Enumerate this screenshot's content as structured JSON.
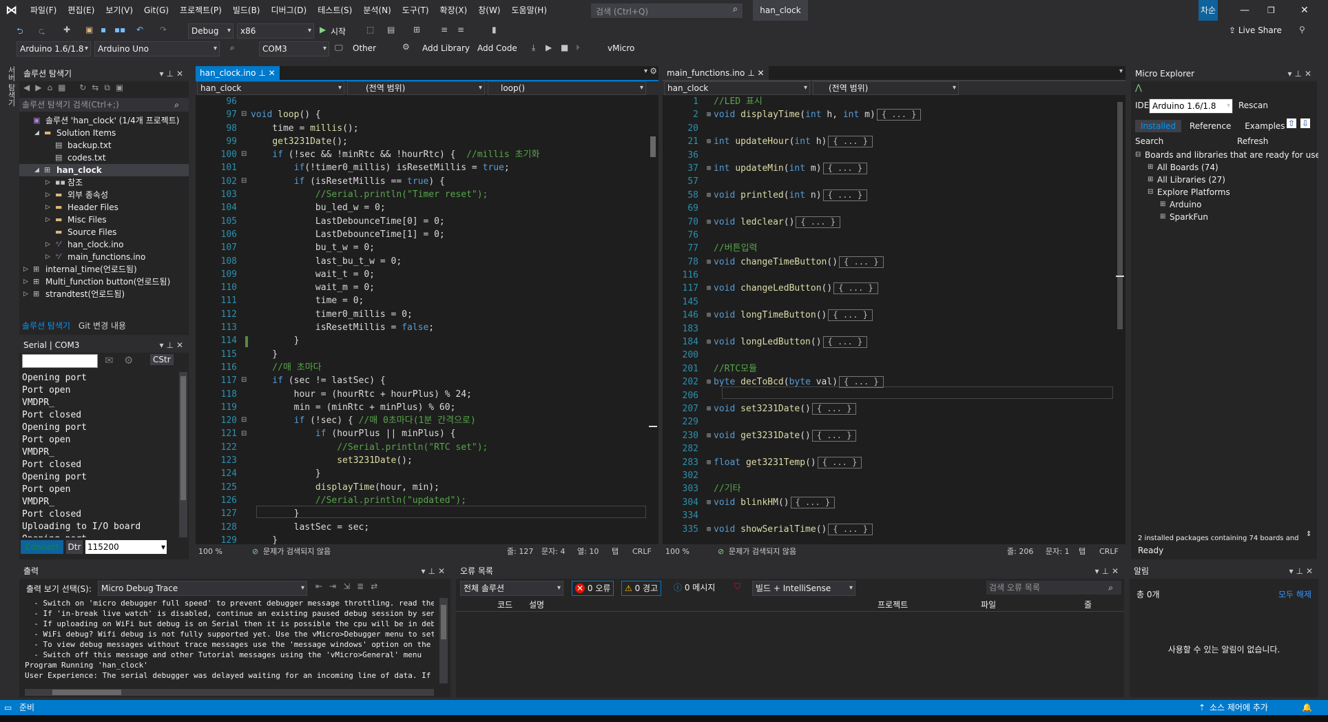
{
  "menu": {
    "items": [
      "파일(F)",
      "편집(E)",
      "보기(V)",
      "Git(G)",
      "프로젝트(P)",
      "빌드(B)",
      "디버그(D)",
      "테스트(S)",
      "분석(N)",
      "도구(T)",
      "확장(X)",
      "창(W)",
      "도움말(H)"
    ],
    "search_placeholder": "검색 (Ctrl+Q)",
    "solution_name": "han_clock",
    "user": "차순"
  },
  "toolbar": {
    "config": "Debug",
    "platform": "x86",
    "start": "시작",
    "live_share": "Live Share",
    "ide_version": "Arduino 1.6/1.8",
    "board": "Arduino Uno",
    "port": "COM3",
    "other": "Other",
    "add_library": "Add Library",
    "add_code": "Add Code",
    "vmicro": "vMicro"
  },
  "solution_explorer": {
    "title": "솔루션 탐색기",
    "search_placeholder": "솔루션 탐색기 검색(Ctrl+;)",
    "items": [
      {
        "label": "솔루션 'han_clock' (1/4개 프로젝트)",
        "indent": 0,
        "icon": "solution-icon",
        "bold": false
      },
      {
        "label": "Solution Items",
        "indent": 1,
        "icon": "folder-icon",
        "bold": false
      },
      {
        "label": "backup.txt",
        "indent": 2,
        "icon": "file-icon",
        "bold": false
      },
      {
        "label": "codes.txt",
        "indent": 2,
        "icon": "file-icon",
        "bold": false
      },
      {
        "label": "han_clock",
        "indent": 1,
        "icon": "project-icon",
        "bold": true
      },
      {
        "label": "참조",
        "indent": 2,
        "icon": "reference-icon",
        "bold": false
      },
      {
        "label": "외부 종속성",
        "indent": 2,
        "icon": "folder-icon",
        "bold": false
      },
      {
        "label": "Header Files",
        "indent": 2,
        "icon": "folder-icon",
        "bold": false
      },
      {
        "label": "Misc Files",
        "indent": 2,
        "icon": "folder-icon",
        "bold": false
      },
      {
        "label": "Source Files",
        "indent": 2,
        "icon": "folder-icon",
        "bold": false
      },
      {
        "label": "han_clock.ino",
        "indent": 2,
        "icon": "cpp-file-icon",
        "bold": false
      },
      {
        "label": "main_functions.ino",
        "indent": 2,
        "icon": "cpp-file-icon",
        "bold": false
      },
      {
        "label": "internal_time(언로드됨)",
        "indent": 0,
        "icon": "project-icon",
        "bold": false
      },
      {
        "label": "Multi_function button(언로드됨)",
        "indent": 0,
        "icon": "project-icon",
        "bold": false
      },
      {
        "label": "strandtest(언로드됨)",
        "indent": 0,
        "icon": "project-icon",
        "bold": false
      }
    ],
    "tabs": [
      "솔루션 탐색기",
      "Git 변경 내용"
    ]
  },
  "serial": {
    "title": "Serial | COM3",
    "cstr": "CStr",
    "connect": "Connect",
    "dtr": "Dtr",
    "baud": "115200",
    "lines": [
      "Opening port",
      "Port open",
      "VMDPR_",
      "Port closed",
      "Opening port",
      "Port open",
      "VMDPR_",
      "Port closed",
      "Opening port",
      "Port open",
      "VMDPR_",
      "Port closed",
      "Uploading to I/O board",
      "Opening port"
    ]
  },
  "editor1": {
    "tab": "han_clock.ino",
    "nav1": "han_clock",
    "nav2": "(전역 범위)",
    "nav3": "loop()",
    "zoom": "100 %",
    "issues": "문제가 검색되지 않음",
    "line": "줄: 127",
    "char": "문자: 4",
    "col": "열: 10",
    "tab_mode": "탭",
    "eol": "CRLF",
    "lines": [
      {
        "n": "96",
        "c": []
      },
      {
        "n": "97",
        "c": [
          [
            "kw",
            "void "
          ],
          [
            "fn",
            "loop"
          ],
          [
            "pl",
            "() {"
          ]
        ]
      },
      {
        "n": "98",
        "c": [
          [
            "pl",
            "    time = "
          ],
          [
            "fn",
            "millis"
          ],
          [
            "pl",
            "();"
          ]
        ]
      },
      {
        "n": "99",
        "c": [
          [
            "pl",
            "    "
          ],
          [
            "fn",
            "get3231Date"
          ],
          [
            "pl",
            "();"
          ]
        ]
      },
      {
        "n": "100",
        "c": [
          [
            "kw",
            "    if"
          ],
          [
            "pl",
            " (!sec && !minRtc && !hourRtc) {  "
          ],
          [
            "cm",
            "//millis 초기화"
          ]
        ]
      },
      {
        "n": "101",
        "c": [
          [
            "kw",
            "        if"
          ],
          [
            "pl",
            "(!timer0_millis) isResetMillis = "
          ],
          [
            "kw",
            "true"
          ],
          [
            "pl",
            ";"
          ]
        ]
      },
      {
        "n": "102",
        "c": [
          [
            "kw",
            "        if"
          ],
          [
            "pl",
            " (isResetMillis == "
          ],
          [
            "kw",
            "true"
          ],
          [
            "pl",
            ") {"
          ]
        ]
      },
      {
        "n": "103",
        "c": [
          [
            "cm",
            "            //Serial.println(\"Timer reset\");"
          ]
        ]
      },
      {
        "n": "104",
        "c": [
          [
            "pl",
            "            bu_led_w = 0;"
          ]
        ]
      },
      {
        "n": "105",
        "c": [
          [
            "pl",
            "            LastDebounceTime[0] = 0;"
          ]
        ]
      },
      {
        "n": "106",
        "c": [
          [
            "pl",
            "            LastDebounceTime[1] = 0;"
          ]
        ]
      },
      {
        "n": "107",
        "c": [
          [
            "pl",
            "            bu_t_w = 0;"
          ]
        ]
      },
      {
        "n": "108",
        "c": [
          [
            "pl",
            "            last_bu_t_w = 0;"
          ]
        ]
      },
      {
        "n": "109",
        "c": [
          [
            "pl",
            "            wait_t = 0;"
          ]
        ]
      },
      {
        "n": "110",
        "c": [
          [
            "pl",
            "            wait_m = 0;"
          ]
        ]
      },
      {
        "n": "111",
        "c": [
          [
            "pl",
            "            time = 0;"
          ]
        ]
      },
      {
        "n": "112",
        "c": [
          [
            "pl",
            "            timer0_millis = 0;"
          ]
        ]
      },
      {
        "n": "113",
        "c": [
          [
            "pl",
            "            isResetMillis = "
          ],
          [
            "kw",
            "false"
          ],
          [
            "pl",
            ";"
          ]
        ]
      },
      {
        "n": "114",
        "c": [
          [
            "pl",
            "        }"
          ]
        ]
      },
      {
        "n": "115",
        "c": [
          [
            "pl",
            "    }"
          ]
        ]
      },
      {
        "n": "116",
        "c": [
          [
            "cm",
            "    //매 초마다"
          ]
        ]
      },
      {
        "n": "117",
        "c": [
          [
            "kw",
            "    if"
          ],
          [
            "pl",
            " (sec != lastSec) {"
          ]
        ]
      },
      {
        "n": "118",
        "c": [
          [
            "pl",
            "        hour = (hourRtc + hourPlus) % 24;"
          ]
        ]
      },
      {
        "n": "119",
        "c": [
          [
            "pl",
            "        min = (minRtc + minPlus) % 60;"
          ]
        ]
      },
      {
        "n": "120",
        "c": [
          [
            "kw",
            "        if"
          ],
          [
            "pl",
            " (!sec) { "
          ],
          [
            "cm",
            "//매 0초마다(1분 간격으로)"
          ]
        ]
      },
      {
        "n": "121",
        "c": [
          [
            "kw",
            "            if"
          ],
          [
            "pl",
            " (hourPlus || minPlus) {"
          ]
        ]
      },
      {
        "n": "122",
        "c": [
          [
            "cm",
            "                //Serial.println(\"RTC set\");"
          ]
        ]
      },
      {
        "n": "123",
        "c": [
          [
            "pl",
            "                "
          ],
          [
            "fn",
            "set3231Date"
          ],
          [
            "pl",
            "();"
          ]
        ]
      },
      {
        "n": "124",
        "c": [
          [
            "pl",
            "            }"
          ]
        ]
      },
      {
        "n": "125",
        "c": [
          [
            "pl",
            "            "
          ],
          [
            "fn",
            "displayTime"
          ],
          [
            "pl",
            "(hour, min);"
          ]
        ]
      },
      {
        "n": "126",
        "c": [
          [
            "cm",
            "            //Serial.println(\"updated\");"
          ]
        ]
      },
      {
        "n": "127",
        "c": [
          [
            "pl",
            "        }"
          ]
        ]
      },
      {
        "n": "128",
        "c": [
          [
            "pl",
            "        lastSec = sec;"
          ]
        ]
      },
      {
        "n": "129",
        "c": [
          [
            "pl",
            "    }"
          ]
        ]
      },
      {
        "n": "130",
        "c": []
      }
    ]
  },
  "editor2": {
    "tab": "main_functions.ino",
    "nav1": "han_clock",
    "nav2": "(전역 범위)",
    "zoom": "100 %",
    "issues": "문제가 검색되지 않음",
    "line": "줄: 206",
    "char": "문자: 1",
    "tab_mode": "탭",
    "eol": "CRLF",
    "lines": [
      {
        "n": "1",
        "c": [
          [
            "cm",
            "//LED 표시"
          ]
        ],
        "fold": false
      },
      {
        "n": "2",
        "c": [
          [
            "kw",
            "void "
          ],
          [
            "fn",
            "displayTime"
          ],
          [
            "pl",
            "("
          ],
          [
            "kw",
            "int"
          ],
          [
            "pl",
            " h, "
          ],
          [
            "kw",
            "int"
          ],
          [
            "pl",
            " m)"
          ]
        ],
        "fold": true
      },
      {
        "n": "20",
        "c": [],
        "fold": false
      },
      {
        "n": "21",
        "c": [
          [
            "kw",
            "int "
          ],
          [
            "fn",
            "updateHour"
          ],
          [
            "pl",
            "("
          ],
          [
            "kw",
            "int"
          ],
          [
            "pl",
            " h)"
          ]
        ],
        "fold": true
      },
      {
        "n": "36",
        "c": [],
        "fold": false
      },
      {
        "n": "37",
        "c": [
          [
            "kw",
            "int "
          ],
          [
            "fn",
            "updateMin"
          ],
          [
            "pl",
            "("
          ],
          [
            "kw",
            "int"
          ],
          [
            "pl",
            " m)"
          ]
        ],
        "fold": true
      },
      {
        "n": "57",
        "c": [],
        "fold": false
      },
      {
        "n": "58",
        "c": [
          [
            "kw",
            "void "
          ],
          [
            "fn",
            "printled"
          ],
          [
            "pl",
            "("
          ],
          [
            "kw",
            "int"
          ],
          [
            "pl",
            " n)"
          ]
        ],
        "fold": true
      },
      {
        "n": "69",
        "c": [],
        "fold": false
      },
      {
        "n": "70",
        "c": [
          [
            "kw",
            "void "
          ],
          [
            "fn",
            "ledclear"
          ],
          [
            "pl",
            "()"
          ]
        ],
        "fold": true
      },
      {
        "n": "76",
        "c": [],
        "fold": false
      },
      {
        "n": "77",
        "c": [
          [
            "cm",
            "//버튼입력"
          ]
        ],
        "fold": false
      },
      {
        "n": "78",
        "c": [
          [
            "kw",
            "void "
          ],
          [
            "fn",
            "changeTimeButton"
          ],
          [
            "pl",
            "()"
          ]
        ],
        "fold": true
      },
      {
        "n": "116",
        "c": [],
        "fold": false
      },
      {
        "n": "117",
        "c": [
          [
            "kw",
            "void "
          ],
          [
            "fn",
            "changeLedButton"
          ],
          [
            "pl",
            "()"
          ]
        ],
        "fold": true
      },
      {
        "n": "145",
        "c": [],
        "fold": false
      },
      {
        "n": "146",
        "c": [
          [
            "kw",
            "void "
          ],
          [
            "fn",
            "longTimeButton"
          ],
          [
            "pl",
            "()"
          ]
        ],
        "fold": true
      },
      {
        "n": "183",
        "c": [],
        "fold": false
      },
      {
        "n": "184",
        "c": [
          [
            "kw",
            "void "
          ],
          [
            "fn",
            "longLedButton"
          ],
          [
            "pl",
            "()"
          ]
        ],
        "fold": true
      },
      {
        "n": "200",
        "c": [],
        "fold": false
      },
      {
        "n": "201",
        "c": [
          [
            "cm",
            "//RTC모듈"
          ]
        ],
        "fold": false
      },
      {
        "n": "202",
        "c": [
          [
            "kw",
            "byte "
          ],
          [
            "fn",
            "decToBcd"
          ],
          [
            "pl",
            "("
          ],
          [
            "kw",
            "byte"
          ],
          [
            "pl",
            " val)"
          ]
        ],
        "fold": true
      },
      {
        "n": "206",
        "c": [],
        "fold": false
      },
      {
        "n": "207",
        "c": [
          [
            "kw",
            "void "
          ],
          [
            "fn",
            "set3231Date"
          ],
          [
            "pl",
            "()"
          ]
        ],
        "fold": true
      },
      {
        "n": "229",
        "c": [],
        "fold": false
      },
      {
        "n": "230",
        "c": [
          [
            "kw",
            "void "
          ],
          [
            "fn",
            "get3231Date"
          ],
          [
            "pl",
            "()"
          ]
        ],
        "fold": true
      },
      {
        "n": "282",
        "c": [],
        "fold": false
      },
      {
        "n": "283",
        "c": [
          [
            "kw",
            "float "
          ],
          [
            "fn",
            "get3231Temp"
          ],
          [
            "pl",
            "()"
          ]
        ],
        "fold": true
      },
      {
        "n": "302",
        "c": [],
        "fold": false
      },
      {
        "n": "303",
        "c": [
          [
            "cm",
            "//기타"
          ]
        ],
        "fold": false
      },
      {
        "n": "304",
        "c": [
          [
            "kw",
            "void "
          ],
          [
            "fn",
            "blinkHM"
          ],
          [
            "pl",
            "()"
          ]
        ],
        "fold": true
      },
      {
        "n": "334",
        "c": [],
        "fold": false
      },
      {
        "n": "335",
        "c": [
          [
            "kw",
            "void "
          ],
          [
            "fn",
            "showSerialTime"
          ],
          [
            "pl",
            "()"
          ]
        ],
        "fold": true
      }
    ],
    "collapsed": "{ ... }"
  },
  "micro": {
    "title": "Micro Explorer",
    "ide_label": "IDE",
    "ide_value": "Arduino 1.6/1.8",
    "rescan": "Rescan",
    "tabs": [
      "Installed",
      "Reference",
      "Examples"
    ],
    "search": "Search",
    "refresh": "Refresh",
    "tree": [
      {
        "label": "Boards and libraries that are ready for use",
        "indent": 0
      },
      {
        "label": "All Boards (74)",
        "indent": 1
      },
      {
        "label": "All Libraries (27)",
        "indent": 1
      },
      {
        "label": "Explore Platforms",
        "indent": 1
      },
      {
        "label": "Arduino",
        "indent": 2
      },
      {
        "label": "SparkFun",
        "indent": 2
      }
    ],
    "footer": "2 installed packages containing 74 boards and",
    "ready": "Ready"
  },
  "output": {
    "title": "출력",
    "select_label": "출력 보기 선택(S):",
    "select_value": "Micro Debug Trace",
    "lines": [
      "  - Switch on 'micro debugger full speed' to prevent debugger message throttling. read the docs",
      "  - If 'in-break live watch' is disabled, continue an existing paused debug session by sending the",
      "  - If uploading on WiFi but debug is on Serial then it is possible the cpu will be in debug break",
      "  - WiFi debug? Wifi debug is not fully supported yet. Use the vMicro>Debugger menu to set an alte",
      "  - To view debug messages without trace messages use the 'message windows' option on the monitor",
      "  - Switch off this message and other Tutorial messages using the 'vMicro>General' menu",
      "Program Running 'han_clock'",
      "User Experience: The serial debugger was delayed waiting for an incoming line of data. If the Serie"
    ]
  },
  "errors": {
    "title": "오류 목록",
    "scope": "전체 솔루션",
    "err": "0 오류",
    "warn": "0 경고",
    "msg": "0 메시지",
    "build": "빌드 + IntelliSense",
    "search_placeholder": "검색 오류 목록",
    "cols": [
      "코드",
      "설명",
      "프로젝트",
      "파일",
      "줄"
    ]
  },
  "notify": {
    "title": "알림",
    "count": "총 0개",
    "clear_all": "모두 해제",
    "empty": "사용할 수 있는 알림이 없습니다."
  },
  "statusbar": {
    "ready": "준비",
    "source_control": "소스 제어에 추가"
  },
  "left_rail": {
    "label": "서버 탐색기"
  }
}
